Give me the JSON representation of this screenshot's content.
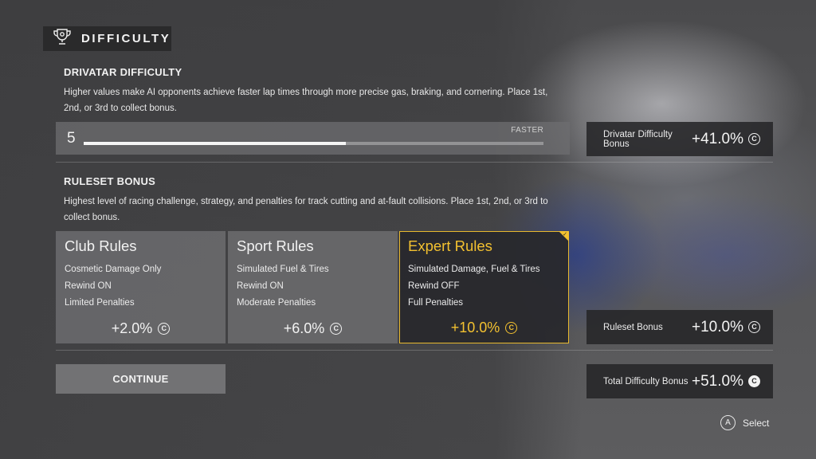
{
  "header": {
    "title": "DIFFICULTY",
    "icon": "trophy-icon"
  },
  "drivatar": {
    "heading": "DRIVATAR DIFFICULTY",
    "description": "Higher values make AI opponents achieve faster lap times through more precise gas, braking, and cornering. Place 1st, 2nd, or 3rd to collect bonus.",
    "slider": {
      "value": "5",
      "end_label": "FASTER",
      "fill_fraction": 0.57
    },
    "bonus": {
      "label": "Drivatar Difficulty Bonus",
      "value": "+41.0%",
      "coin_symbol": "C"
    }
  },
  "ruleset": {
    "heading": "RULESET BONUS",
    "description": "Highest level of racing challenge, strategy, and penalties for track cutting and at-fault collisions. Place 1st, 2nd, or 3rd to collect bonus.",
    "cards": [
      {
        "title": "Club Rules",
        "lines": [
          "Cosmetic Damage Only",
          "Rewind ON",
          "Limited Penalties"
        ],
        "bonus": "+2.0%",
        "selected": false
      },
      {
        "title": "Sport Rules",
        "lines": [
          "Simulated Fuel & Tires",
          "Rewind ON",
          "Moderate Penalties"
        ],
        "bonus": "+6.0%",
        "selected": false
      },
      {
        "title": "Expert Rules",
        "lines": [
          "Simulated Damage, Fuel & Tires",
          "Rewind OFF",
          "Full Penalties"
        ],
        "bonus": "+10.0%",
        "selected": true
      }
    ],
    "bonus": {
      "label": "Ruleset Bonus",
      "value": "+10.0%",
      "coin_symbol": "C"
    }
  },
  "total": {
    "label": "Total Difficulty Bonus",
    "value": "+51.0%",
    "coin_symbol": "C"
  },
  "continue_label": "CONTINUE",
  "hint": {
    "button": "A",
    "label": "Select"
  },
  "colors": {
    "accent": "#f3c130",
    "panel_dark": "#2a2a2b"
  }
}
